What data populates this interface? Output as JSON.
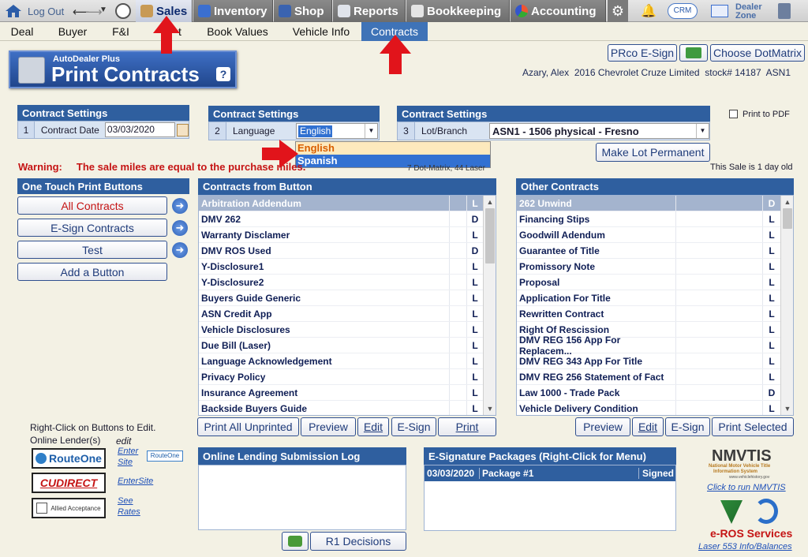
{
  "nav": {
    "logout": "Log Out",
    "tabs": [
      {
        "label": "Sales"
      },
      {
        "label": "Inventory"
      },
      {
        "label": "Shop"
      },
      {
        "label": "Reports"
      },
      {
        "label": "Bookkeeping"
      },
      {
        "label": "Accounting"
      }
    ],
    "crm": "CRM",
    "dealer_zone_1": "Dealer",
    "dealer_zone_2": "Zone"
  },
  "subnav": [
    "Deal",
    "Buyer",
    "F&I",
    "t",
    "Book Values",
    "Vehicle Info",
    "Contracts"
  ],
  "logo": {
    "small": "AutoDealer Plus",
    "big": "Print Contracts",
    "help": "?"
  },
  "top_buttons": {
    "esign": "PRco E-Sign",
    "dotmatrix": "Choose DotMatrix"
  },
  "customer": {
    "name": "Azary, Alex",
    "vehicle": "2016 Chevrolet Cruze Limited",
    "stock": "stock# 14187",
    "lot": "ASN1"
  },
  "settings": [
    {
      "title": "Contract Settings",
      "num": "1",
      "label": "Contract Date",
      "value": "03/03/2020"
    },
    {
      "title": "Contract Settings",
      "num": "2",
      "label": "Language",
      "value": "English"
    },
    {
      "title": "Contract Settings",
      "num": "3",
      "label": "Lot/Branch",
      "value": "ASN1 - 1506 physical - Fresno"
    }
  ],
  "language_options": [
    "English",
    "Spanish"
  ],
  "print_to_pdf": "Print to PDF",
  "make_lot_permanent": "Make Lot Permanent",
  "warning": {
    "label": "Warning:",
    "text": "The sale miles are equal to the purchase miles."
  },
  "printer_note": "7 Dot-Matrix, 44 Laser",
  "sale_age": "This Sale is 1 day old",
  "one_touch": {
    "title": "One Touch Print Buttons",
    "buttons": [
      "All Contracts",
      "E-Sign Contracts",
      "Test",
      "Add a Button"
    ]
  },
  "contracts_from_button": {
    "title": "Contracts from Button",
    "rows": [
      {
        "name": "Arbitration Addendum",
        "code": "L"
      },
      {
        "name": "DMV 262",
        "code": "D"
      },
      {
        "name": "Warranty Disclamer",
        "code": "L"
      },
      {
        "name": "DMV ROS Used",
        "code": "D"
      },
      {
        "name": "Y-Disclosure1",
        "code": "L"
      },
      {
        "name": "Y-Disclosure2",
        "code": "L"
      },
      {
        "name": "Buyers Guide Generic",
        "code": "L"
      },
      {
        "name": "ASN Credit App",
        "code": "L"
      },
      {
        "name": "Vehicle Disclosures",
        "code": "L"
      },
      {
        "name": "Due Bill (Laser)",
        "code": "L"
      },
      {
        "name": "Language Acknowledgement",
        "code": "L"
      },
      {
        "name": "Privacy Policy",
        "code": "L"
      },
      {
        "name": "Insurance Agreement",
        "code": "L"
      },
      {
        "name": "Backside Buyers Guide",
        "code": "L"
      }
    ],
    "buttons": [
      "Print All Unprinted",
      "Preview",
      "Edit",
      "E-Sign",
      "Print"
    ]
  },
  "other_contracts": {
    "title": "Other Contracts",
    "rows": [
      {
        "name": "262 Unwind",
        "code": "D"
      },
      {
        "name": "Financing Stips",
        "code": "L"
      },
      {
        "name": "Goodwill Adendum",
        "code": "L"
      },
      {
        "name": "Guarantee of Title",
        "code": "L"
      },
      {
        "name": "Promissory Note",
        "code": "L"
      },
      {
        "name": "Proposal",
        "code": "L"
      },
      {
        "name": "Application For Title",
        "code": "L"
      },
      {
        "name": "Rewritten Contract",
        "code": "L"
      },
      {
        "name": "Right Of Rescission",
        "code": "L"
      },
      {
        "name": "DMV REG 156 App For Replacem...",
        "code": "L"
      },
      {
        "name": "DMV REG 343 App For Title",
        "code": "L"
      },
      {
        "name": "DMV REG 256 Statement of Fact",
        "code": "L"
      },
      {
        "name": "Law 1000 - Trade Pack",
        "code": "D"
      },
      {
        "name": "Vehicle Delivery Condition",
        "code": "L"
      }
    ],
    "buttons": [
      "Preview",
      "Edit",
      "E-Sign",
      "Print Selected"
    ]
  },
  "lenders": {
    "note": "Right-Click on Buttons to Edit.",
    "title": "Online Lender(s)",
    "edit": "edit",
    "items": [
      {
        "logo": "RouteOne",
        "link1": "Enter",
        "link2": "Site",
        "badge": "RouteOne"
      },
      {
        "logo": "CUDIRECT",
        "link1": "EnterSite",
        "link2": ""
      },
      {
        "logo": "Allied Acceptance",
        "link1": "See",
        "link2": "Rates"
      }
    ]
  },
  "lending_log": {
    "title": "Online Lending Submission Log"
  },
  "r1_decisions": "R1 Decisions",
  "esign_packages": {
    "title": "E-Signature Packages (Right-Click for Menu)",
    "row": {
      "date": "03/03/2020",
      "name": "Package #1",
      "status": "Signed"
    }
  },
  "nmvtis": {
    "logo": "NMVTIS",
    "sub1": "National Motor Vehicle Title",
    "sub2": "Information System",
    "sub3": "www.vehiclehistory.gov",
    "link": "Click to run NMVTIS"
  },
  "eros": {
    "title": "e-ROS Services",
    "link": "Laser 553 Info/Balances"
  },
  "colors": {
    "header_blue": "#2f5f9f",
    "warning_red": "#c51414",
    "arrow_red": "#e1141b",
    "accent_blue": "#3f73b7"
  }
}
